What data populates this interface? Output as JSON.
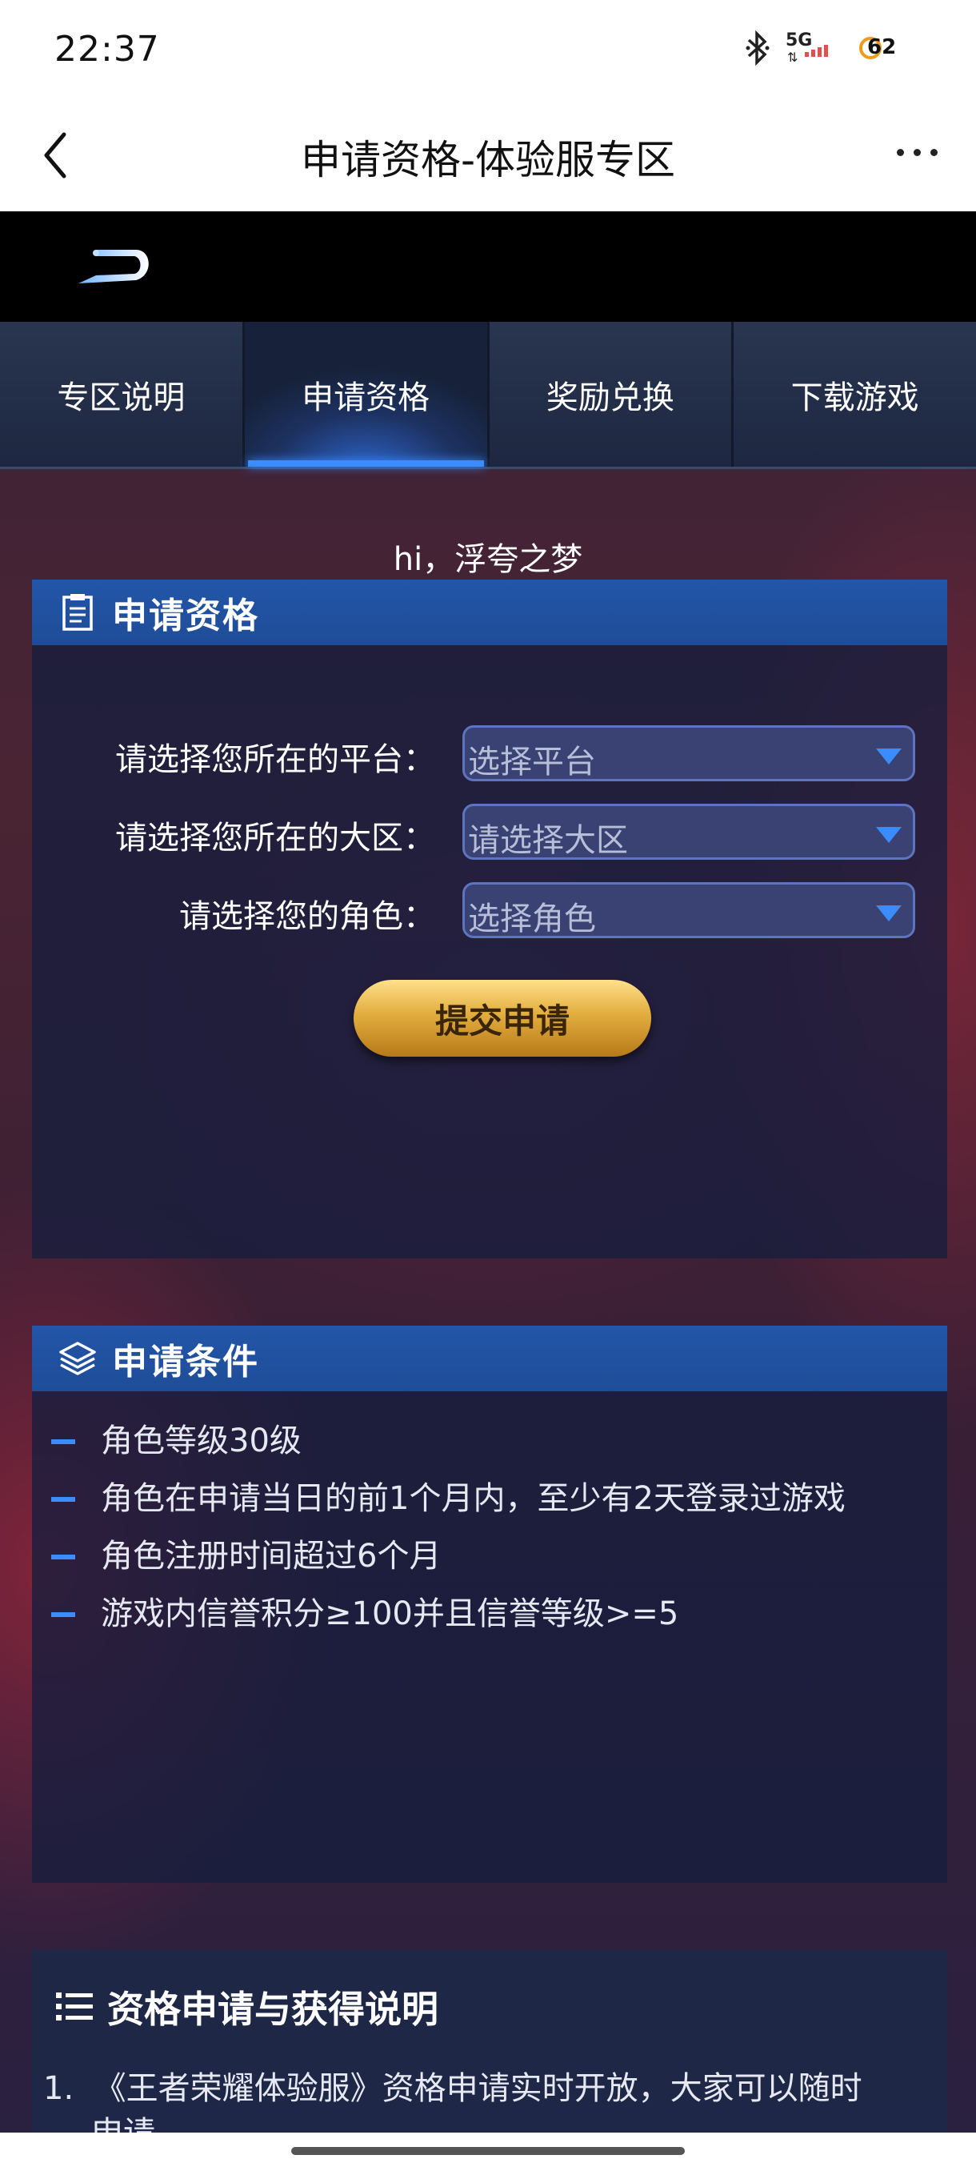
{
  "status": {
    "time": "22:37",
    "network": "5G",
    "battery": "62"
  },
  "header": {
    "title": "申请资格-体验服专区"
  },
  "tabs": [
    {
      "label": "专区说明",
      "active": false
    },
    {
      "label": "申请资格",
      "active": true
    },
    {
      "label": "奖励兑换",
      "active": false
    },
    {
      "label": "下载游戏",
      "active": false
    }
  ],
  "greeting": "hi，浮夸之梦",
  "apply": {
    "title": "申请资格",
    "fields": [
      {
        "label": "请选择您所在的平台：",
        "value": "选择平台"
      },
      {
        "label": "请选择您所在的大区：",
        "value": "请选择大区"
      },
      {
        "label": "请选择您的角色：",
        "value": "选择角色"
      }
    ],
    "submit": "提交申请"
  },
  "conditions": {
    "title": "申请条件",
    "items": [
      "角色等级30级",
      "角色在申请当日的前1个月内，至少有2天登录过游戏",
      "角色注册时间超过6个月",
      "游戏内信誉积分≥100并且信誉等级>=5"
    ]
  },
  "info": {
    "title": "资格申请与获得说明",
    "num": "1.",
    "line1": "《王者荣耀体验服》资格申请实时开放，大家可以随时",
    "line2": "申请"
  },
  "colors": {
    "accent": "#3a8cff",
    "panel_head": "#2356a8",
    "button_gold": "#e2ad3e"
  }
}
